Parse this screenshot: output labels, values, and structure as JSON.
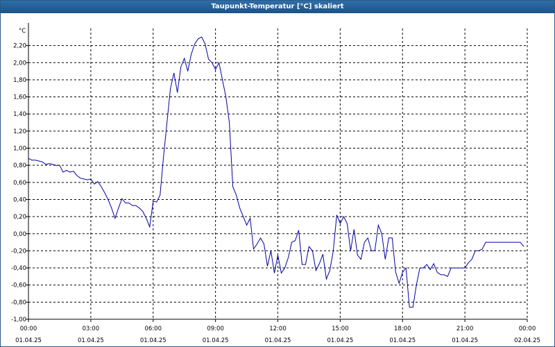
{
  "window": {
    "title": "Taupunkt-Temperatur [°C] skaliert"
  },
  "chart_data": {
    "type": "line",
    "title": "Taupunkt-Temperatur [°C] skaliert",
    "ylabel": "°C",
    "ylim": [
      -1.0,
      2.4
    ],
    "y_ticks": [
      -1.0,
      -0.8,
      -0.6,
      -0.4,
      -0.2,
      0.0,
      0.2,
      0.4,
      0.6,
      0.8,
      1.0,
      1.2,
      1.4,
      1.6,
      1.8,
      2.0,
      2.2
    ],
    "y_tick_labels": [
      "-1,00",
      "-0,80",
      "-0,60",
      "-0,40",
      "-0,20",
      "0,00",
      "0,20",
      "0,40",
      "0,60",
      "0,80",
      "1,00",
      "1,20",
      "1,40",
      "1,60",
      "1,80",
      "2,00",
      "2,20"
    ],
    "x_tick_times": [
      "00:00",
      "03:00",
      "06:00",
      "09:00",
      "12:00",
      "15:00",
      "18:00",
      "21:00",
      "00:00"
    ],
    "x_tick_dates": [
      "01.04.25",
      "01.04.25",
      "01.04.25",
      "01.04.25",
      "01.04.25",
      "01.04.25",
      "01.04.25",
      "01.04.25",
      "02.04.25"
    ],
    "grid": true,
    "line_color": "#0000a0",
    "series": [
      {
        "x": [
          "00:00",
          "00:10",
          "00:20",
          "00:30",
          "00:40",
          "00:50",
          "01:00",
          "01:10",
          "01:20",
          "01:30",
          "01:40",
          "01:50",
          "02:00",
          "02:10",
          "02:20",
          "02:30",
          "02:40",
          "02:50",
          "03:00",
          "03:10",
          "03:20",
          "03:30",
          "03:40",
          "03:50",
          "04:00",
          "04:10",
          "04:20",
          "04:30",
          "04:40",
          "04:50",
          "05:00",
          "05:10",
          "05:20",
          "05:30",
          "05:40",
          "05:50",
          "06:00",
          "06:10",
          "06:20",
          "06:30",
          "06:40",
          "06:50",
          "07:00",
          "07:10",
          "07:20",
          "07:30",
          "07:40",
          "07:50",
          "08:00",
          "08:10",
          "08:20",
          "08:30",
          "08:40",
          "08:50",
          "09:00",
          "09:10",
          "09:20",
          "09:30",
          "09:40",
          "09:50",
          "10:00",
          "10:10",
          "10:20",
          "10:30",
          "10:40",
          "10:50",
          "11:00",
          "11:10",
          "11:20",
          "11:30",
          "11:40",
          "11:50",
          "12:00",
          "12:10",
          "12:20",
          "12:30",
          "12:40",
          "12:50",
          "13:00",
          "13:10",
          "13:20",
          "13:30",
          "13:40",
          "13:50",
          "14:00",
          "14:10",
          "14:20",
          "14:30",
          "14:40",
          "14:50",
          "15:00",
          "15:10",
          "15:20",
          "15:30",
          "15:40",
          "15:50",
          "16:00",
          "16:10",
          "16:20",
          "16:30",
          "16:40",
          "16:50",
          "17:00",
          "17:10",
          "17:20",
          "17:30",
          "17:40",
          "17:50",
          "18:00",
          "18:10",
          "18:20",
          "18:30",
          "18:40",
          "18:50",
          "19:00",
          "19:10",
          "19:20",
          "19:30",
          "19:40",
          "19:50",
          "20:00",
          "20:10",
          "20:20",
          "20:30",
          "20:40",
          "20:50",
          "21:00",
          "21:10",
          "21:20",
          "21:30",
          "21:40",
          "21:50",
          "22:00",
          "22:10",
          "22:20",
          "22:30",
          "22:40",
          "22:50",
          "23:00",
          "23:10",
          "23:20",
          "23:30",
          "23:40",
          "23:50"
        ],
        "y": [
          0.88,
          0.86,
          0.86,
          0.85,
          0.84,
          0.81,
          0.82,
          0.81,
          0.8,
          0.8,
          0.72,
          0.74,
          0.72,
          0.73,
          0.68,
          0.65,
          0.64,
          0.63,
          0.64,
          0.58,
          0.61,
          0.55,
          0.48,
          0.4,
          0.3,
          0.18,
          0.3,
          0.41,
          0.36,
          0.36,
          0.33,
          0.33,
          0.3,
          0.26,
          0.18,
          0.08,
          0.38,
          0.37,
          0.45,
          0.9,
          1.3,
          1.7,
          1.88,
          1.65,
          1.95,
          2.05,
          1.9,
          2.1,
          2.22,
          2.28,
          2.3,
          2.22,
          2.04,
          2.0,
          1.92,
          2.0,
          1.8,
          1.6,
          1.3,
          0.55,
          0.45,
          0.3,
          0.2,
          0.1,
          0.18,
          -0.18,
          -0.12,
          -0.05,
          -0.12,
          -0.38,
          -0.2,
          -0.46,
          -0.25,
          -0.46,
          -0.4,
          -0.28,
          -0.1,
          -0.08,
          0.04,
          -0.36,
          -0.36,
          -0.15,
          -0.2,
          -0.43,
          -0.35,
          -0.24,
          -0.53,
          -0.43,
          -0.2,
          0.22,
          0.12,
          0.2,
          0.12,
          -0.2,
          0.05,
          -0.25,
          -0.3,
          -0.1,
          -0.05,
          -0.2,
          -0.2,
          0.1,
          0.0,
          -0.3,
          -0.05,
          -0.05,
          -0.45,
          -0.58,
          -0.45,
          -0.4,
          -0.86,
          -0.86,
          -0.6,
          -0.4,
          -0.4,
          -0.36,
          -0.42,
          -0.35,
          -0.45,
          -0.48,
          -0.48,
          -0.5,
          -0.4,
          -0.4,
          -0.4,
          -0.4,
          -0.4,
          -0.34,
          -0.3,
          -0.2,
          -0.2,
          -0.18,
          -0.1,
          -0.1,
          -0.1,
          -0.1,
          -0.1,
          -0.1,
          -0.1,
          -0.1,
          -0.1,
          -0.1,
          -0.1,
          -0.15
        ]
      }
    ]
  }
}
